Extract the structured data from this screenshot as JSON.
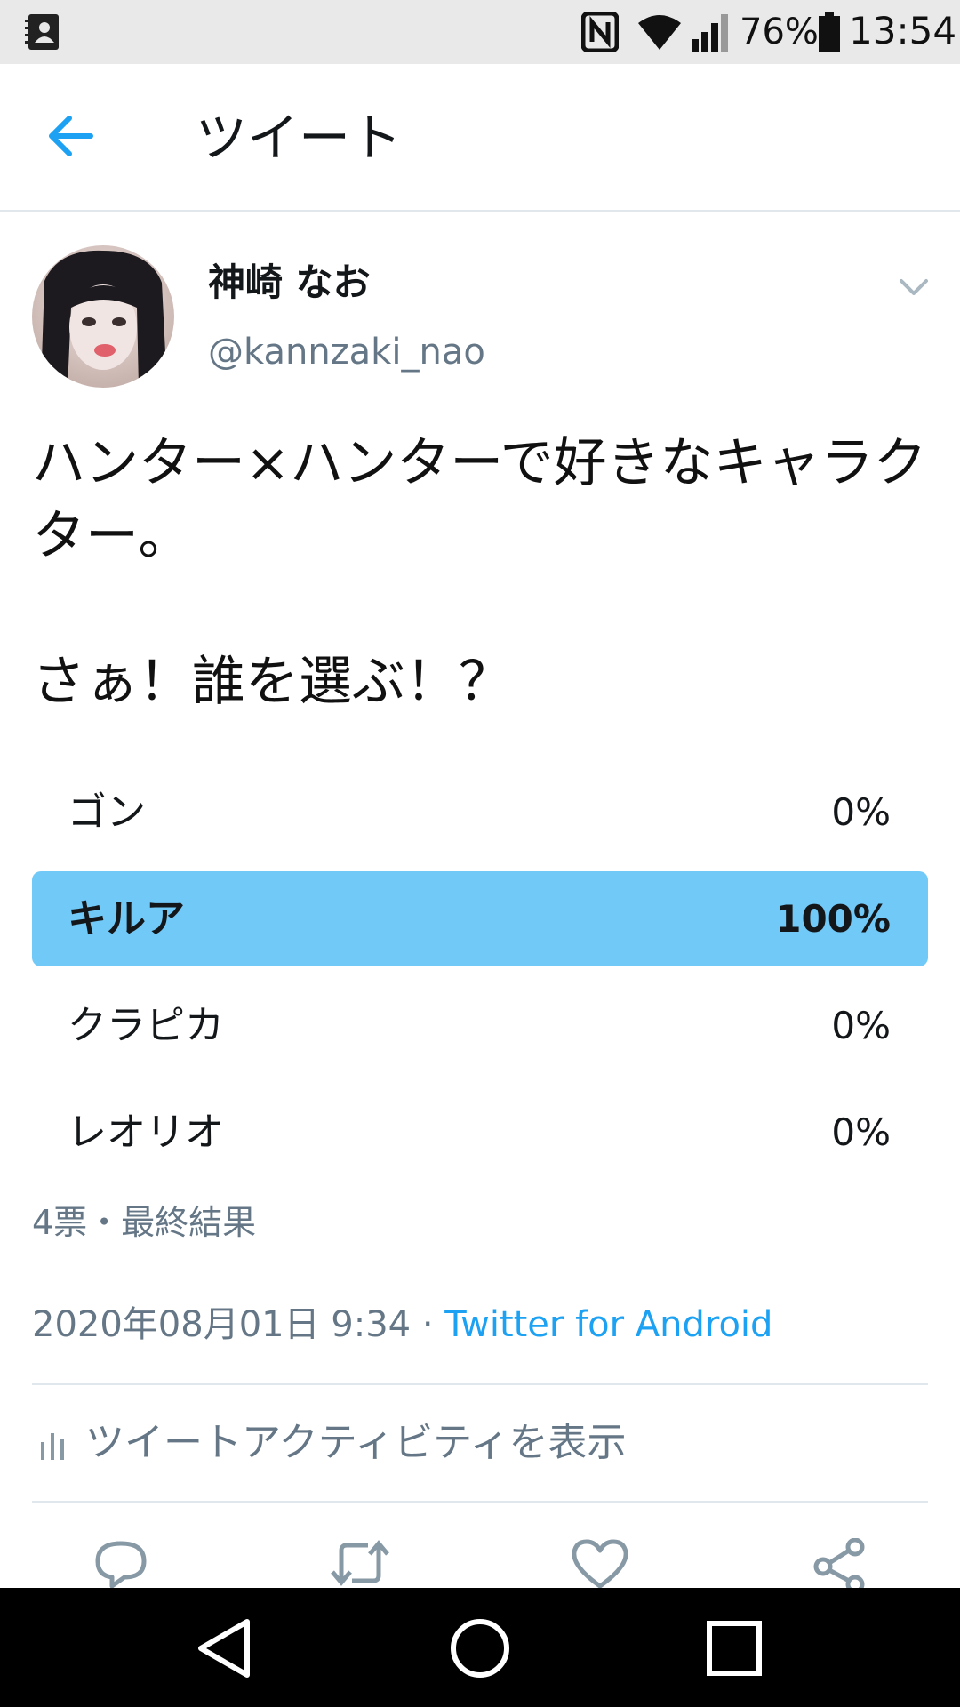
{
  "status_bar": {
    "battery_percent": "76%",
    "time": "13:54",
    "icons": [
      "contacts-icon",
      "nfc-icon",
      "wifi-icon",
      "signal-icon",
      "battery-icon"
    ]
  },
  "header": {
    "title": "ツイート",
    "back_icon": "arrow-left-icon"
  },
  "tweet": {
    "author": {
      "display_name": "神崎 なお",
      "handle": "@kannzaki_nao"
    },
    "text": "ハンター×ハンターで好きなキャラクター。\n\nさぁ！誰を選ぶ！？",
    "poll": {
      "options": [
        {
          "label": "ゴン",
          "percent": "0%",
          "value": 0
        },
        {
          "label": "キルア",
          "percent": "100%",
          "value": 100
        },
        {
          "label": "クラピカ",
          "percent": "0%",
          "value": 0
        },
        {
          "label": "レオリオ",
          "percent": "0%",
          "value": 0
        }
      ],
      "summary": "4票・最終結果"
    },
    "timestamp": "2020年08月01日 9:34",
    "separator": " · ",
    "source": "Twitter for Android",
    "activity_label": "ツイートアクティビティを表示"
  },
  "actions": [
    "reply-icon",
    "retweet-icon",
    "like-icon",
    "share-icon"
  ],
  "colors": {
    "accent": "#1da1f2",
    "poll_winner": "#71c9f8",
    "muted": "#657786",
    "divider": "#e1e8ed"
  }
}
